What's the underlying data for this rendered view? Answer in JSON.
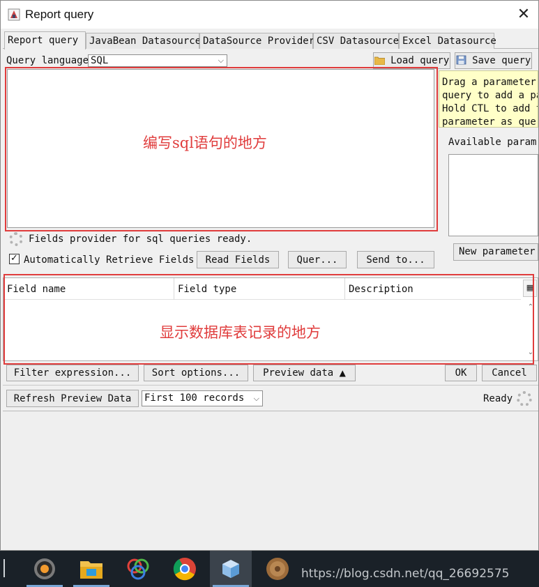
{
  "window": {
    "title": "Report query",
    "close_glyph": "✕"
  },
  "tabs": [
    {
      "label": "Report query",
      "active": true
    },
    {
      "label": "JavaBean Datasource",
      "active": false
    },
    {
      "label": "DataSource Provider",
      "active": false
    },
    {
      "label": "CSV Datasource",
      "active": false
    },
    {
      "label": "Excel Datasource",
      "active": false
    }
  ],
  "query": {
    "language_label": "Query language",
    "language_value": "SQL",
    "load_label": "Load query",
    "save_label": "Save query",
    "annotation": "编写sql语句的地方",
    "status_text": "Fields provider for sql queries ready.",
    "auto_retrieve_label": "Automatically Retrieve Fields",
    "auto_retrieve_checked": true,
    "read_fields_label": "Read Fields",
    "query_button_label": "Quer...",
    "send_to_label": "Send to..."
  },
  "params": {
    "hint_lines": [
      "Drag a parameter",
      "query to add a pa",
      "Hold CTL to add t",
      "parameter as quer"
    ],
    "available_label": "Available param",
    "new_parameter_label": "New parameter"
  },
  "fields": {
    "columns": [
      "Field name",
      "Field type",
      "Description"
    ],
    "annotation": "显示数据库表记录的地方"
  },
  "toolbar": {
    "filter_label": "Filter expression...",
    "sort_label": "Sort options...",
    "preview_label": "Preview data",
    "preview_arrow": "▲",
    "ok_label": "OK",
    "cancel_label": "Cancel"
  },
  "preview": {
    "refresh_label": "Refresh Preview Data",
    "records_value": "First 100 records",
    "status": "Ready"
  },
  "taskbar": {
    "watermark": "https://blog.csdn.net/qq_26692575",
    "apps": [
      {
        "icon": "eclipse-javaee-icon"
      },
      {
        "icon": "file-explorer-icon"
      },
      {
        "icon": "photos-app-icon"
      },
      {
        "icon": "chrome-icon"
      },
      {
        "icon": "cube-app-icon"
      },
      {
        "icon": "media-app-icon"
      }
    ]
  },
  "colors": {
    "annotation_red": "#e03c3c",
    "hint_yellow": "#ffffc8",
    "taskbar_bg": "#1a2128"
  }
}
